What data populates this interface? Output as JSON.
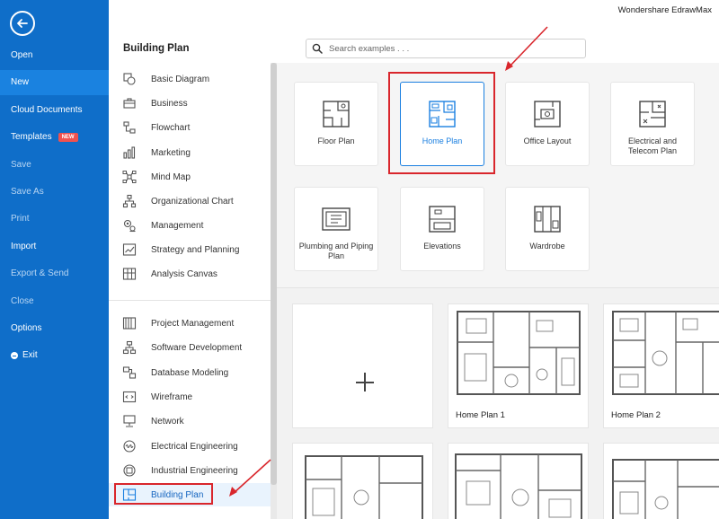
{
  "app": {
    "title": "Wondershare EdrawMax"
  },
  "leftnav": {
    "items": [
      {
        "label": "Open"
      },
      {
        "label": "New"
      },
      {
        "label": "Cloud Documents"
      },
      {
        "label": "Templates",
        "badge": "NEW"
      },
      {
        "label": "Save"
      },
      {
        "label": "Save As"
      },
      {
        "label": "Print"
      },
      {
        "label": "Import"
      },
      {
        "label": "Export & Send"
      },
      {
        "label": "Close"
      },
      {
        "label": "Options"
      },
      {
        "label": "Exit"
      }
    ]
  },
  "panel": {
    "title": "Building Plan"
  },
  "search": {
    "placeholder": "Search examples . . ."
  },
  "categories": [
    {
      "label": "Basic Diagram"
    },
    {
      "label": "Business"
    },
    {
      "label": "Flowchart"
    },
    {
      "label": "Marketing"
    },
    {
      "label": "Mind Map"
    },
    {
      "label": "Organizational Chart"
    },
    {
      "label": "Management"
    },
    {
      "label": "Strategy and Planning"
    },
    {
      "label": "Analysis Canvas"
    },
    {
      "label": "Project Management"
    },
    {
      "label": "Software Development"
    },
    {
      "label": "Database Modeling"
    },
    {
      "label": "Wireframe"
    },
    {
      "label": "Network"
    },
    {
      "label": "Electrical Engineering"
    },
    {
      "label": "Industrial Engineering"
    },
    {
      "label": "Building Plan"
    }
  ],
  "types": [
    {
      "label": "Floor Plan",
      "icon": "floor-plan-icon"
    },
    {
      "label": "Home Plan",
      "icon": "home-plan-icon"
    },
    {
      "label": "Office Layout",
      "icon": "office-layout-icon"
    },
    {
      "label": "Electrical and Telecom Plan",
      "icon": "electrical-plan-icon"
    },
    {
      "label": "Plumbing and Piping Plan",
      "icon": "plumbing-plan-icon"
    },
    {
      "label": "Elevations",
      "icon": "elevations-icon"
    },
    {
      "label": "Wardrobe",
      "icon": "wardrobe-icon"
    }
  ],
  "examples": [
    {
      "name": "Home Plan 1"
    },
    {
      "name": "Home Plan 2"
    }
  ],
  "colors": {
    "sidebar": "#0f6ec9",
    "accent": "#1a7fe0",
    "highlight": "#d9262c"
  }
}
